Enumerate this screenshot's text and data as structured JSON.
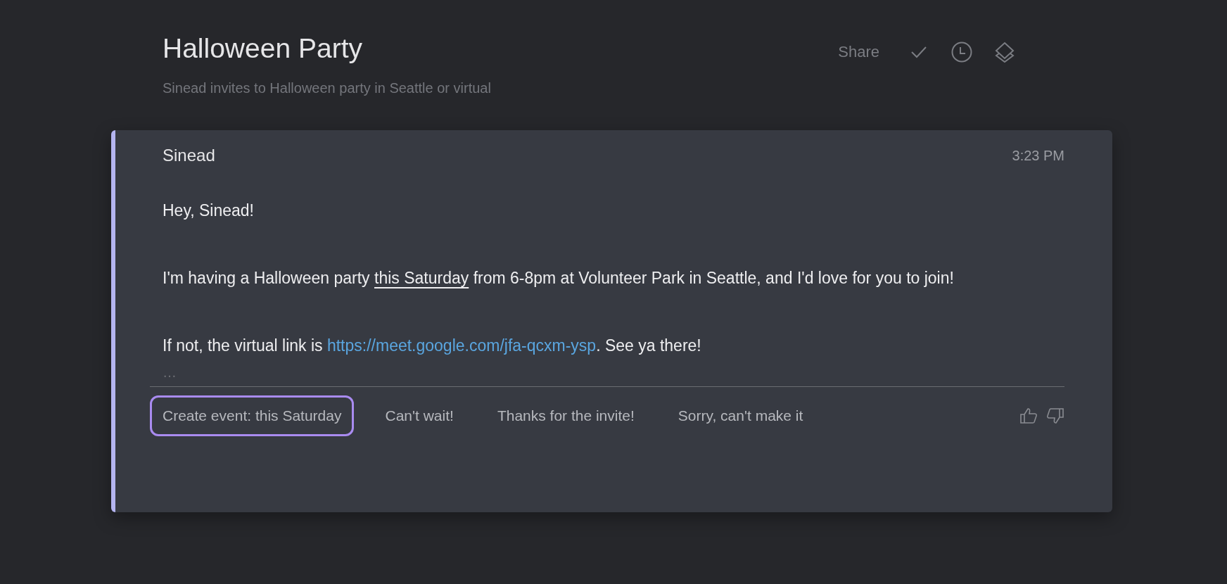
{
  "header": {
    "title": "Halloween Party",
    "subtitle": "Sinead invites to Halloween party in Seattle or virtual",
    "actions": [
      {
        "kind": "text",
        "label": "Share"
      },
      {
        "kind": "check"
      },
      {
        "kind": "clock"
      },
      {
        "kind": "layers"
      }
    ]
  },
  "message": {
    "sender": "Sinead",
    "time": "3:23 PM",
    "paragraphs": [
      [
        {
          "kind": "text",
          "text": "Hey, Sinead!"
        }
      ],
      [
        {
          "kind": "text",
          "text": "I'm having a Halloween party "
        },
        {
          "kind": "date",
          "text": "this Saturday"
        },
        {
          "kind": "text",
          "text": " from 6-8pm at Volunteer Park in Seattle, and I'd love for you to join!"
        }
      ],
      [
        {
          "kind": "text",
          "text": "If not, the virtual link is "
        },
        {
          "kind": "link",
          "text": "https://meet.google.com/jfa-qcxm-ysp"
        },
        {
          "kind": "text",
          "text": ". See ya there!"
        }
      ]
    ],
    "more": "…",
    "suggestions": [
      {
        "label": "Create event: this Saturday",
        "selected": true
      },
      {
        "label": "Can't wait!",
        "selected": false
      },
      {
        "label": "Thanks for the invite!",
        "selected": false
      },
      {
        "label": "Sorry, can't make it",
        "selected": false
      }
    ]
  }
}
